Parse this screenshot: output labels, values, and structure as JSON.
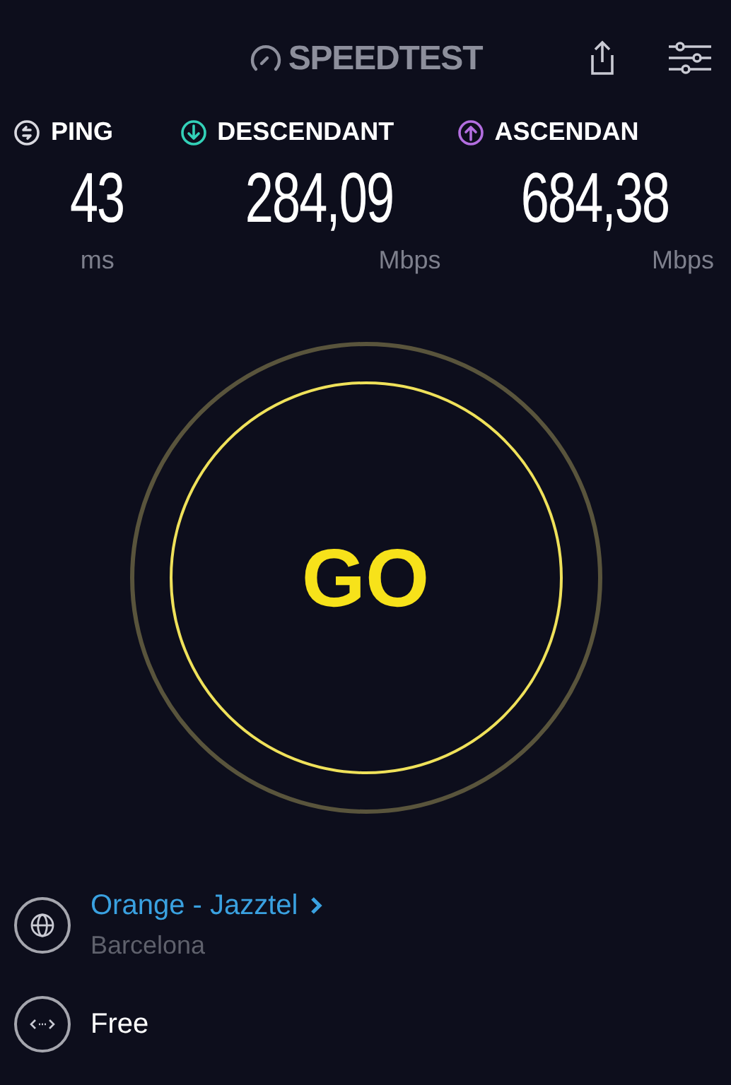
{
  "header": {
    "logo": "SPEEDTEST"
  },
  "metrics": [
    {
      "kind": "ping",
      "label": "PING",
      "value": "43",
      "unit": "ms",
      "color": "#d9d9e0"
    },
    {
      "kind": "download",
      "label": "DESCENDANT",
      "value": "284,09",
      "unit": "Mbps",
      "color": "#33d1b8"
    },
    {
      "kind": "upload",
      "label": "ASCENDAN",
      "value": "684,38",
      "unit": "Mbps",
      "color": "#b36ee0"
    }
  ],
  "go_button": {
    "label": "GO"
  },
  "provider": {
    "name": "Orange - Jazztel",
    "location": "Barcelona"
  },
  "connection": {
    "label": "Free"
  }
}
